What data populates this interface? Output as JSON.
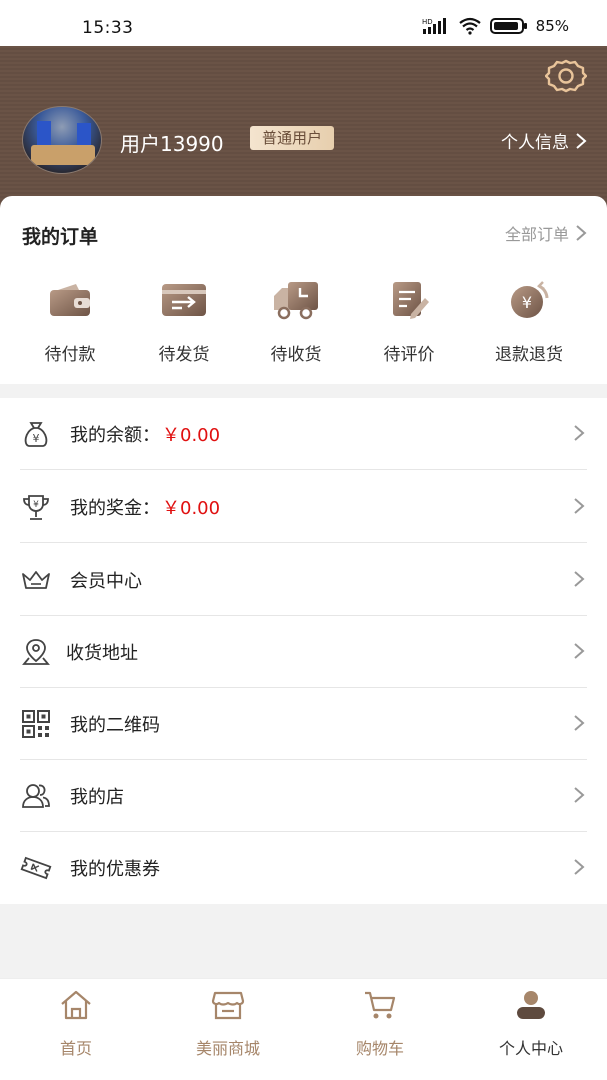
{
  "status_bar": {
    "time": "15:33",
    "battery": "85%"
  },
  "header": {
    "username": "用户13990",
    "badge": "普通用户",
    "profile_link": "个人信息"
  },
  "orders": {
    "title": "我的订单",
    "all_link": "全部订单",
    "items": [
      {
        "label": "待付款",
        "icon": "wallet-icon"
      },
      {
        "label": "待发货",
        "icon": "card-send-icon"
      },
      {
        "label": "待收货",
        "icon": "delivery-truck-icon"
      },
      {
        "label": "待评价",
        "icon": "review-pen-icon"
      },
      {
        "label": "退款退货",
        "icon": "refund-coin-icon"
      }
    ]
  },
  "menu": [
    {
      "label": "我的余额：",
      "value": "￥0.00",
      "icon": "money-bag-icon"
    },
    {
      "label": "我的奖金：",
      "value": "￥0.00",
      "icon": "trophy-icon"
    },
    {
      "label": "会员中心",
      "icon": "crown-icon"
    },
    {
      "label": "收货地址",
      "icon": "map-pin-icon"
    },
    {
      "label": "我的二维码",
      "icon": "qr-code-icon"
    },
    {
      "label": "我的店",
      "icon": "users-icon"
    },
    {
      "label": "我的优惠券",
      "icon": "coupon-icon"
    }
  ],
  "tabbar": [
    {
      "label": "首页",
      "icon": "home-icon",
      "active": false
    },
    {
      "label": "美丽商城",
      "icon": "store-icon",
      "active": false
    },
    {
      "label": "购物车",
      "icon": "cart-icon",
      "active": false
    },
    {
      "label": "个人中心",
      "icon": "profile-icon",
      "active": true
    }
  ],
  "colors": {
    "brand": "#6a5346",
    "accent_text": "#a6866a",
    "price": "#e01010"
  }
}
